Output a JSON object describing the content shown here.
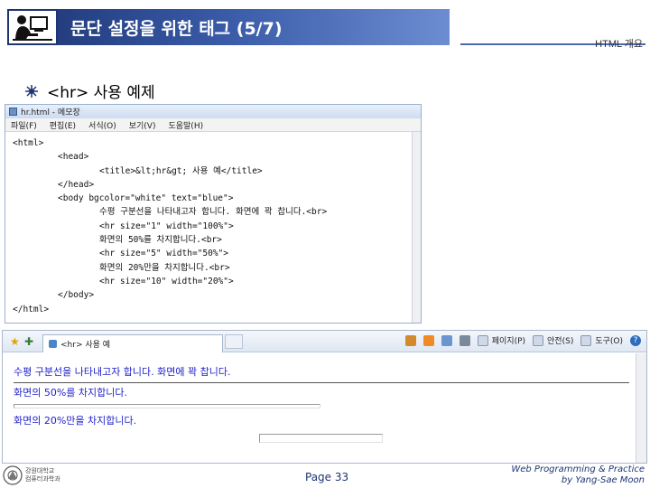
{
  "slide": {
    "title": "문단 설정을 위한 태그 (5/7)",
    "header_right": "HTML 개요",
    "bullet_text": "<hr> 사용 예제",
    "page_number": "Page 33",
    "footer_line1": "Web Programming & Practice",
    "footer_line2": "by Yang-Sae Moon",
    "footer_logo_line1": "강원대학교",
    "footer_logo_line2": "컴퓨터과학과"
  },
  "notepad": {
    "title": "hr.html - 메모장",
    "menu": [
      "파일(F)",
      "편집(E)",
      "서식(O)",
      "보기(V)",
      "도움말(H)"
    ],
    "lines": [
      {
        "indent": 0,
        "text": "<html>"
      },
      {
        "indent": 1,
        "text": "<head>"
      },
      {
        "indent": 2,
        "text": "<title>&lt;hr&gt; 사용 예</title>"
      },
      {
        "indent": 1,
        "text": "</head>"
      },
      {
        "indent": 1,
        "text": "<body bgcolor=\"white\" text=\"blue\">"
      },
      {
        "indent": 2,
        "text": "수평 구분선을 나타내고자 합니다. 화면에 꽉 찹니다.<br>"
      },
      {
        "indent": 2,
        "text": "<hr size=\"1\" width=\"100%\">"
      },
      {
        "indent": 2,
        "text": "화면의 50%를 차지합니다.<br>"
      },
      {
        "indent": 2,
        "text": "<hr size=\"5\" width=\"50%\">"
      },
      {
        "indent": 2,
        "text": "화면의 20%만을 차지합니다.<br>"
      },
      {
        "indent": 2,
        "text": "<hr size=\"10\" width=\"20%\">"
      },
      {
        "indent": 1,
        "text": "</body>"
      },
      {
        "indent": 0,
        "text": "</html>"
      }
    ]
  },
  "browser": {
    "tab_title": "<hr> 사용 예",
    "toolbar": {
      "page_label": "페이지(P)",
      "safety_label": "안전(S)",
      "tools_label": "도구(O)",
      "help_label": "?"
    },
    "text1": "수평 구분선을 나타내고자 합니다. 화면에 꽉 찹니다.",
    "text2": "화면의 50%를 차지합니다.",
    "text3": "화면의 20%만을 차지합니다."
  },
  "colors": {
    "title_bar": "#1d3573",
    "browser_text": "#2222cc"
  }
}
